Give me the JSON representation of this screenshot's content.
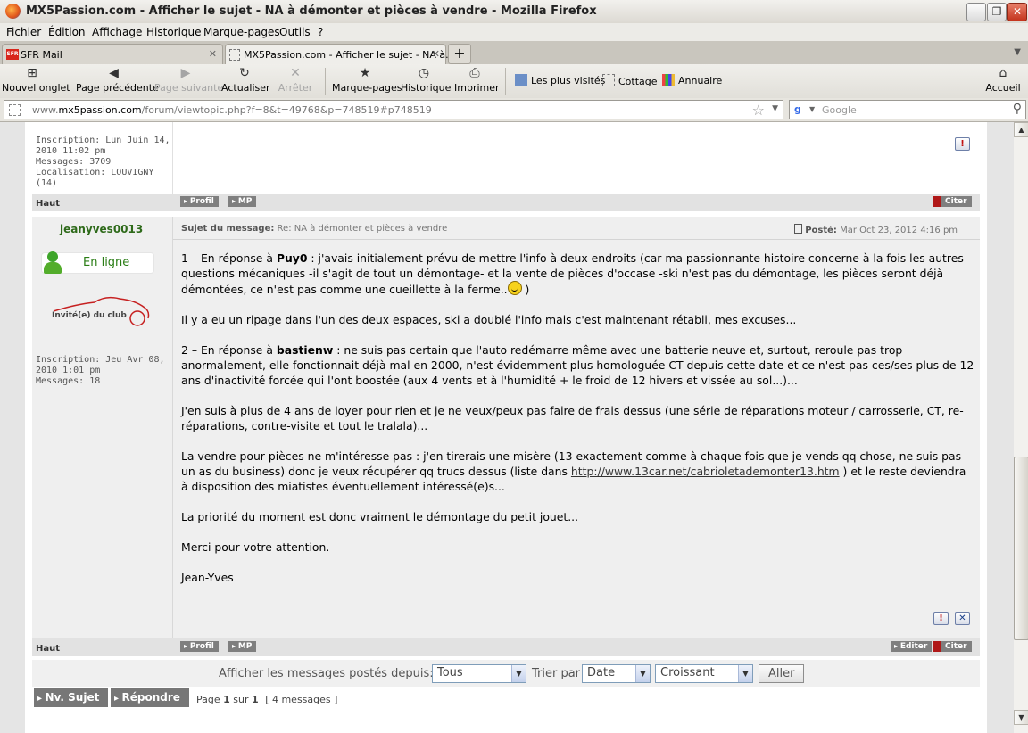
{
  "window": {
    "title": "MX5Passion.com - Afficher le sujet - NA à démonter et pièces à vendre - Mozilla Firefox"
  },
  "menu": [
    "Fichier",
    "Édition",
    "Affichage",
    "Historique",
    "Marque-pages",
    "Outils",
    "?"
  ],
  "tabs": [
    {
      "label": "SFR Mail",
      "active": false
    },
    {
      "label": "MX5Passion.com - Afficher le sujet - NA à...",
      "active": true
    }
  ],
  "toolbar": {
    "new_tab": "Nouvel onglet",
    "back": "Page précédente",
    "forward": "Page suivante",
    "reload": "Actualiser",
    "stop": "Arrêter",
    "bookmarks": "Marque-pages",
    "history": "Historique",
    "print": "Imprimer",
    "home": "Accueil"
  },
  "bookmarks_bar": [
    "Les plus visités",
    "Cottage",
    "Annuaire"
  ],
  "address": {
    "prefix": "www.",
    "domain": "mx5passion.com",
    "path": "/forum/viewtopic.php?f=8&t=49768&p=748519#p748519"
  },
  "search": {
    "placeholder": "Google"
  },
  "prev_post": {
    "profile_lines": [
      "Inscription: Lun Juin 14,",
      "2010 11:02 pm",
      "Messages: 3709",
      "Localisation: LOUVIGNY",
      "(14)"
    ],
    "top_link": "Haut",
    "buttons": {
      "profile": "Profil",
      "pm": "MP",
      "quote": "Citer"
    }
  },
  "post": {
    "author": "jeanyves0013",
    "online_label": "En ligne",
    "rank_label": "Invité(e) du club",
    "profile_lines": [
      "Inscription: Jeu Avr 08,",
      "2010 1:01 pm",
      "Messages: 18"
    ],
    "subject_label": "Sujet du message:",
    "subject": "Re: NA à démonter et pièces à vendre",
    "posted_label": "Posté:",
    "posted_date": "Mar Oct 23, 2012 4:16 pm",
    "p1_a": "1 – En réponse à ",
    "p1_user": "Puy0",
    "p1_b": " : j'avais initialement prévu de mettre l'info à deux endroits (car ma passionnante histoire concerne à la fois les autres questions mécaniques -il s'agit de tout un démontage- et la vente de pièces d'occase -ski n'est pas du démontage, les pièces seront déjà démontées, ce n'est pas comme une cueillette à la ferme..",
    "p1_c": " )",
    "p2": "Il y a eu un ripage dans l'un des deux espaces, ski a doublé l'info mais c'est maintenant rétabli, mes excuses...",
    "p3_a": "2 – En réponse à ",
    "p3_user": "bastienw",
    "p3_b": " : ne suis pas certain que l'auto redémarre même avec une batterie neuve et, surtout, reroule pas trop anormalement, elle fonctionnait déjà mal en 2000, n'est évidemment plus homologuée CT depuis cette date et ce n'est pas ces/ses plus de 12 ans d'inactivité forcée qui l'ont boostée (aux 4 vents et à l'humidité + le froid de 12 hivers et vissée au sol...)...",
    "p4": "J'en suis à plus de 4 ans de loyer pour rien et je ne veux/peux pas faire de frais dessus (une série de réparations moteur / carrosserie, CT, re-réparations, contre-visite et tout le tralala)...",
    "p5_a": "La vendre pour pièces ne m'intéresse pas : j'en tirerais une misère (13 exactement comme à chaque fois que je vends qq chose, ne suis pas un as du business) donc je veux récupérer qq trucs dessus (liste dans ",
    "p5_link": "http://www.13car.net/cabrioletademonter13.htm",
    "p5_b": " ) et le reste deviendra à disposition des miatistes éventuellement intéressé(e)s...",
    "p6": "La priorité du moment est donc vraiment le démontage du petit jouet...",
    "p7": "Merci pour votre attention.",
    "p8": "Jean-Yves",
    "top_link": "Haut",
    "buttons": {
      "profile": "Profil",
      "pm": "MP",
      "edit": "Editer",
      "quote": "Citer"
    }
  },
  "filter": {
    "label": "Afficher les messages postés depuis:",
    "period": "Tous",
    "sort_label": "Trier par",
    "sort_by": "Date",
    "order": "Croissant",
    "go": "Aller"
  },
  "actions": {
    "new_topic": "Nv. Sujet",
    "reply": "Répondre"
  },
  "pagination": {
    "page_word": "Page",
    "current": "1",
    "of_word": "sur",
    "total": "1",
    "count_text": "[ 4 messages ]"
  },
  "colors": {
    "online_green": "#2a7d15",
    "username_green": "#2e6a1a",
    "button_grey": "#7f7f7f",
    "quote_red": "#b01818"
  }
}
